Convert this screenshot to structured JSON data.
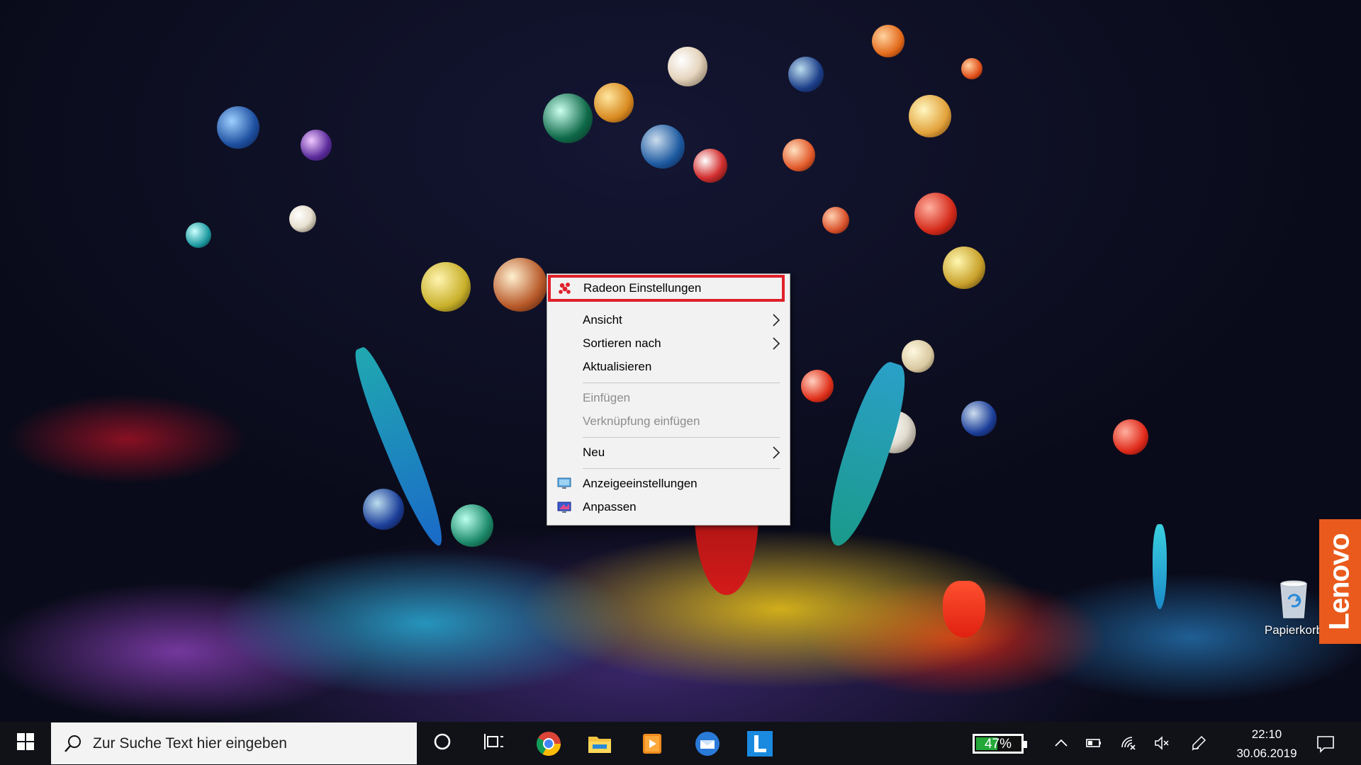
{
  "desktop": {
    "recycle_bin_label": "Papierkorb",
    "brand_tab_label": "Lenovo"
  },
  "context_menu": {
    "items": [
      {
        "label": "Radeon Einstellungen",
        "icon": "radeon-icon",
        "highlighted": true
      },
      {
        "label": "Ansicht",
        "submenu": true
      },
      {
        "label": "Sortieren nach",
        "submenu": true
      },
      {
        "label": "Aktualisieren"
      },
      {
        "label": "Einfügen",
        "disabled": true
      },
      {
        "label": "Verknüpfung einfügen",
        "disabled": true
      },
      {
        "label": "Neu",
        "submenu": true
      },
      {
        "label": "Anzeigeeinstellungen",
        "icon": "display-settings-icon"
      },
      {
        "label": "Anpassen",
        "icon": "personalize-icon"
      }
    ]
  },
  "taskbar": {
    "search_placeholder": "Zur Suche Text hier eingeben",
    "pinned_apps": [
      "cortana-icon",
      "task-view-icon",
      "chrome-icon",
      "file-explorer-icon",
      "media-player-icon",
      "mail-icon",
      "lenovo-vantage-icon"
    ],
    "battery_percent": "47%",
    "battery_level": 0.47,
    "time": "22:10",
    "date": "30.06.2019"
  },
  "colors": {
    "highlight_border": "#e0202a",
    "battery_fill": "#24a83a",
    "lenovo_orange": "#e95a1c",
    "taskbar_bg": "#101218"
  }
}
